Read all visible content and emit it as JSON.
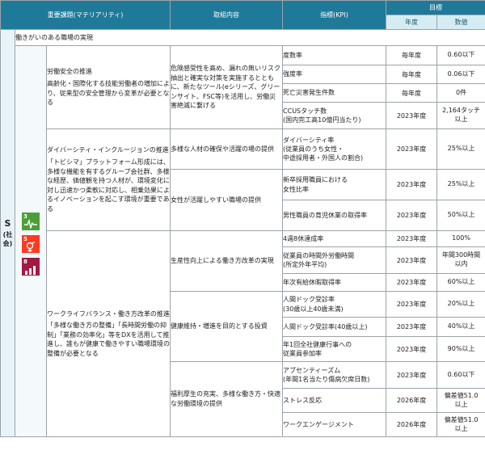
{
  "header": {
    "topic": "重要課題(マテリアリティ)",
    "initiative": "取組内容",
    "kpi": "指標(KPI)",
    "target": "目標",
    "year": "年度",
    "value": "数値"
  },
  "pillar": {
    "letter": "S",
    "word": "(社会)"
  },
  "sdg_icons": [
    {
      "number": "3",
      "name": "good-health-icon",
      "color": "#4c9f38"
    },
    {
      "number": "5",
      "name": "gender-equality-icon",
      "color": "#ff3a21"
    },
    {
      "number": "8",
      "name": "decent-work-icon",
      "color": "#a21942"
    }
  ],
  "section_title": "働きがいのある職場の実現",
  "topics": [
    {
      "title": "労働安全の推進",
      "desc": "高齢化・国際化する技能労働者の増加により、従来型の安全管理から変革が必要となる"
    },
    {
      "title": "ダイバーシティ・インクルージョンの推進",
      "desc": "「トビシマ」プラットフォーム形成には、多様な機能を有するグループ会社群、多様な経歴、価値観を持つ人材が、環境変化に対し迅速かつ柔軟に対応し、相乗効果によるイノベーションを起こす環境が重要である"
    },
    {
      "title": "ワークライフバランス・働き方改革の推進",
      "desc": "「多様な働き方の整備」「長時間労働の抑制」「業務の効率化」等をDXを活用して推進し、誰もが健康で働きやすい職場環境の整備が必要となる"
    }
  ],
  "initiatives": [
    "危険感受性を高め、漏れの無いリスク抽出と確実な対策を実施するとともに、新たなツール(eシリーズ、グリーンサイト、FSC等)を活用し、労働災害絶滅に繋げる",
    "多様な人材の確保や活躍の場の提供",
    "女性が活躍しやすい職場の提供",
    "生産性向上による働き方改革の実現",
    "健康維持・増進を目的とする投資",
    "福利厚生の充実、多様な働き方・快適な労働環境の提供"
  ],
  "rows": [
    {
      "kpi": "度数率",
      "year": "毎年度",
      "value": "0.60以下"
    },
    {
      "kpi": "強度率",
      "year": "毎年度",
      "value": "0.06以下"
    },
    {
      "kpi": "死亡災害発生件数",
      "year": "毎年度",
      "value": "0件"
    },
    {
      "kpi": "CCUSタッチ数\n(国内完工高10億円当たり)",
      "year": "2023年度",
      "value": "2,164タッチ\n以上"
    },
    {
      "kpi": "ダイバーシティ率\n(従業員のうち女性・\n中途採用者・外国人の割合)",
      "year": "2023年度",
      "value": "25%以上"
    },
    {
      "kpi": "新卒採用職員における\n女性比率",
      "year": "2023年度",
      "value": "25%以上"
    },
    {
      "kpi": "男性職員の育児休業の取得率",
      "year": "2023年度",
      "value": "50%以上"
    },
    {
      "kpi": "4週8休達成率",
      "year": "2023年度",
      "value": "100%"
    },
    {
      "kpi": "従業員の時間外労働時間\n(所定外年平均)",
      "year": "2023年度",
      "value": "年間300時間\n以内"
    },
    {
      "kpi": "年次有給休暇取得率",
      "year": "2023年度",
      "value": "60%以上"
    },
    {
      "kpi": "人間ドック受診率\n(30歳以上40歳未満)",
      "year": "2023年度",
      "value": "20%以上"
    },
    {
      "kpi": "人間ドック受診率(40歳以上)",
      "year": "2023年度",
      "value": "40%以上"
    },
    {
      "kpi": "年1回全社健康行事への\n従業員参加率",
      "year": "2023年度",
      "value": "90%以上"
    },
    {
      "kpi": "アブセンティーズム\n(年間1名当たり傷病欠席日数)",
      "year": "2023年度",
      "value": "0.60以下"
    },
    {
      "kpi": "ストレス反応",
      "year": "2026年度",
      "value": "偏差値51.0\n以上"
    },
    {
      "kpi": "ワークエンゲージメント",
      "year": "2026年度",
      "value": "偏差値51.0\n以上"
    }
  ]
}
